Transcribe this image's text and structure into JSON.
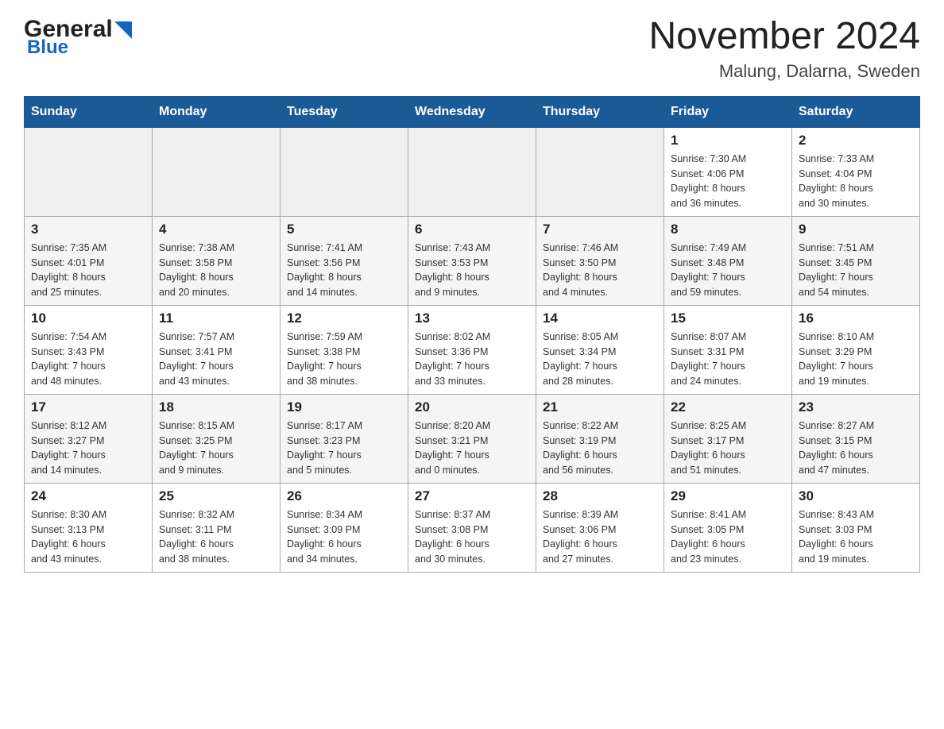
{
  "header": {
    "logo_general": "General",
    "logo_blue": "Blue",
    "month_year": "November 2024",
    "location": "Malung, Dalarna, Sweden"
  },
  "days_of_week": [
    "Sunday",
    "Monday",
    "Tuesday",
    "Wednesday",
    "Thursday",
    "Friday",
    "Saturday"
  ],
  "weeks": [
    [
      {
        "day": "",
        "info": ""
      },
      {
        "day": "",
        "info": ""
      },
      {
        "day": "",
        "info": ""
      },
      {
        "day": "",
        "info": ""
      },
      {
        "day": "",
        "info": ""
      },
      {
        "day": "1",
        "info": "Sunrise: 7:30 AM\nSunset: 4:06 PM\nDaylight: 8 hours\nand 36 minutes."
      },
      {
        "day": "2",
        "info": "Sunrise: 7:33 AM\nSunset: 4:04 PM\nDaylight: 8 hours\nand 30 minutes."
      }
    ],
    [
      {
        "day": "3",
        "info": "Sunrise: 7:35 AM\nSunset: 4:01 PM\nDaylight: 8 hours\nand 25 minutes."
      },
      {
        "day": "4",
        "info": "Sunrise: 7:38 AM\nSunset: 3:58 PM\nDaylight: 8 hours\nand 20 minutes."
      },
      {
        "day": "5",
        "info": "Sunrise: 7:41 AM\nSunset: 3:56 PM\nDaylight: 8 hours\nand 14 minutes."
      },
      {
        "day": "6",
        "info": "Sunrise: 7:43 AM\nSunset: 3:53 PM\nDaylight: 8 hours\nand 9 minutes."
      },
      {
        "day": "7",
        "info": "Sunrise: 7:46 AM\nSunset: 3:50 PM\nDaylight: 8 hours\nand 4 minutes."
      },
      {
        "day": "8",
        "info": "Sunrise: 7:49 AM\nSunset: 3:48 PM\nDaylight: 7 hours\nand 59 minutes."
      },
      {
        "day": "9",
        "info": "Sunrise: 7:51 AM\nSunset: 3:45 PM\nDaylight: 7 hours\nand 54 minutes."
      }
    ],
    [
      {
        "day": "10",
        "info": "Sunrise: 7:54 AM\nSunset: 3:43 PM\nDaylight: 7 hours\nand 48 minutes."
      },
      {
        "day": "11",
        "info": "Sunrise: 7:57 AM\nSunset: 3:41 PM\nDaylight: 7 hours\nand 43 minutes."
      },
      {
        "day": "12",
        "info": "Sunrise: 7:59 AM\nSunset: 3:38 PM\nDaylight: 7 hours\nand 38 minutes."
      },
      {
        "day": "13",
        "info": "Sunrise: 8:02 AM\nSunset: 3:36 PM\nDaylight: 7 hours\nand 33 minutes."
      },
      {
        "day": "14",
        "info": "Sunrise: 8:05 AM\nSunset: 3:34 PM\nDaylight: 7 hours\nand 28 minutes."
      },
      {
        "day": "15",
        "info": "Sunrise: 8:07 AM\nSunset: 3:31 PM\nDaylight: 7 hours\nand 24 minutes."
      },
      {
        "day": "16",
        "info": "Sunrise: 8:10 AM\nSunset: 3:29 PM\nDaylight: 7 hours\nand 19 minutes."
      }
    ],
    [
      {
        "day": "17",
        "info": "Sunrise: 8:12 AM\nSunset: 3:27 PM\nDaylight: 7 hours\nand 14 minutes."
      },
      {
        "day": "18",
        "info": "Sunrise: 8:15 AM\nSunset: 3:25 PM\nDaylight: 7 hours\nand 9 minutes."
      },
      {
        "day": "19",
        "info": "Sunrise: 8:17 AM\nSunset: 3:23 PM\nDaylight: 7 hours\nand 5 minutes."
      },
      {
        "day": "20",
        "info": "Sunrise: 8:20 AM\nSunset: 3:21 PM\nDaylight: 7 hours\nand 0 minutes."
      },
      {
        "day": "21",
        "info": "Sunrise: 8:22 AM\nSunset: 3:19 PM\nDaylight: 6 hours\nand 56 minutes."
      },
      {
        "day": "22",
        "info": "Sunrise: 8:25 AM\nSunset: 3:17 PM\nDaylight: 6 hours\nand 51 minutes."
      },
      {
        "day": "23",
        "info": "Sunrise: 8:27 AM\nSunset: 3:15 PM\nDaylight: 6 hours\nand 47 minutes."
      }
    ],
    [
      {
        "day": "24",
        "info": "Sunrise: 8:30 AM\nSunset: 3:13 PM\nDaylight: 6 hours\nand 43 minutes."
      },
      {
        "day": "25",
        "info": "Sunrise: 8:32 AM\nSunset: 3:11 PM\nDaylight: 6 hours\nand 38 minutes."
      },
      {
        "day": "26",
        "info": "Sunrise: 8:34 AM\nSunset: 3:09 PM\nDaylight: 6 hours\nand 34 minutes."
      },
      {
        "day": "27",
        "info": "Sunrise: 8:37 AM\nSunset: 3:08 PM\nDaylight: 6 hours\nand 30 minutes."
      },
      {
        "day": "28",
        "info": "Sunrise: 8:39 AM\nSunset: 3:06 PM\nDaylight: 6 hours\nand 27 minutes."
      },
      {
        "day": "29",
        "info": "Sunrise: 8:41 AM\nSunset: 3:05 PM\nDaylight: 6 hours\nand 23 minutes."
      },
      {
        "day": "30",
        "info": "Sunrise: 8:43 AM\nSunset: 3:03 PM\nDaylight: 6 hours\nand 19 minutes."
      }
    ]
  ]
}
